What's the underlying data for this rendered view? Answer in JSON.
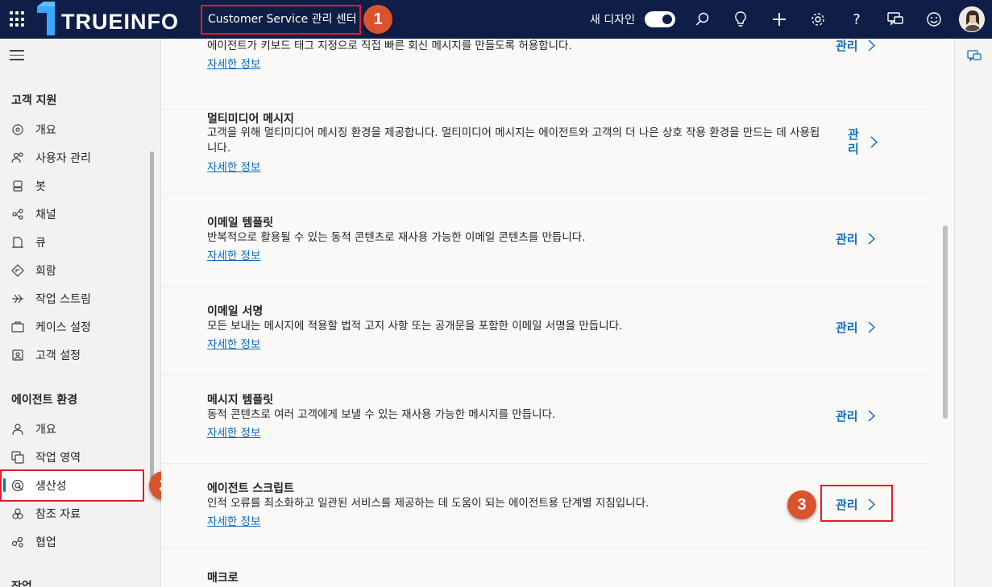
{
  "header": {
    "logo_text": "TRUEINFO",
    "app_title": "Customer Service 관리 센터",
    "new_design_label": "새 디자인",
    "new_design_on": true
  },
  "badges": [
    "1",
    "2",
    "3"
  ],
  "icons": [
    "waffle-icon",
    "search-icon",
    "lightbulb-icon",
    "plus-icon",
    "gear-icon",
    "help-icon",
    "chat-icon",
    "smiley-icon"
  ],
  "sidebar": {
    "sections": [
      {
        "title": "고객 지원",
        "items": [
          {
            "label": "개요",
            "icon": "overview-icon"
          },
          {
            "label": "사용자 관리",
            "icon": "people-icon"
          },
          {
            "label": "봇",
            "icon": "bot-icon"
          },
          {
            "label": "채널",
            "icon": "channel-icon"
          },
          {
            "label": "큐",
            "icon": "queue-icon"
          },
          {
            "label": "회람",
            "icon": "routing-icon"
          },
          {
            "label": "작업 스트림",
            "icon": "workstream-icon"
          },
          {
            "label": "케이스 설정",
            "icon": "case-icon"
          },
          {
            "label": "고객 설정",
            "icon": "customer-icon"
          }
        ]
      },
      {
        "title": "에이전트 환경",
        "items": [
          {
            "label": "개요",
            "icon": "person-icon"
          },
          {
            "label": "작업 영역",
            "icon": "workspace-icon"
          },
          {
            "label": "생산성",
            "icon": "productivity-icon",
            "selected": true
          },
          {
            "label": "참조 자료",
            "icon": "knowledge-icon"
          },
          {
            "label": "협업",
            "icon": "collaboration-icon"
          }
        ]
      },
      {
        "title": "작업",
        "items": []
      }
    ]
  },
  "main": {
    "top_partial": {
      "description": "에이전트가 키보드 태그 지정으로 직접 빠른 회신 메시지를 만들도록 허용합니다.",
      "link": "자세한 정보",
      "manage": "관리"
    },
    "cards": [
      {
        "title": "멀티미디어 메시지",
        "description": "고객을 위해 멀티미디어 메시징 환경을 제공합니다. 멀티미디어 메시지는 에이전트와 고객의 더 나은 상호 작용 환경을 만드는 데 사용됩니다.",
        "link": "자세한 정보",
        "manage": "관리"
      },
      {
        "title": "이메일 템플릿",
        "description": "반복적으로 활용될 수 있는 동적 콘텐츠로 재사용 가능한 이메일 콘텐츠를 만듭니다.",
        "link": "자세한 정보",
        "manage": "관리"
      },
      {
        "title": "이메일 서명",
        "description": "모든 보내는 메시지에 적용할 법적 고지 사항 또는 공개문을 포함한 이메일 서명을 만듭니다.",
        "link": "자세한 정보",
        "manage": "관리"
      },
      {
        "title": "메시지 템플릿",
        "description": "동적 콘텐츠로 여러 고객에게 보낼 수 있는 재사용 가능한 메시지를 만듭니다.",
        "link": "자세한 정보",
        "manage": "관리"
      },
      {
        "title": "에이전트 스크립트",
        "description": "인적 오류를 최소화하고 일관된 서비스를 제공하는 데 도움이 되는 에이전트용 단계별 지침입니다.",
        "link": "자세한 정보",
        "manage": "관리"
      },
      {
        "title": "매크로",
        "description": "",
        "link": "",
        "manage": ""
      }
    ]
  },
  "colors": {
    "topbar": "#0f1e46",
    "accent": "#0f6cbd",
    "highlight": "#e11d2b",
    "badge": "#d9532e"
  }
}
